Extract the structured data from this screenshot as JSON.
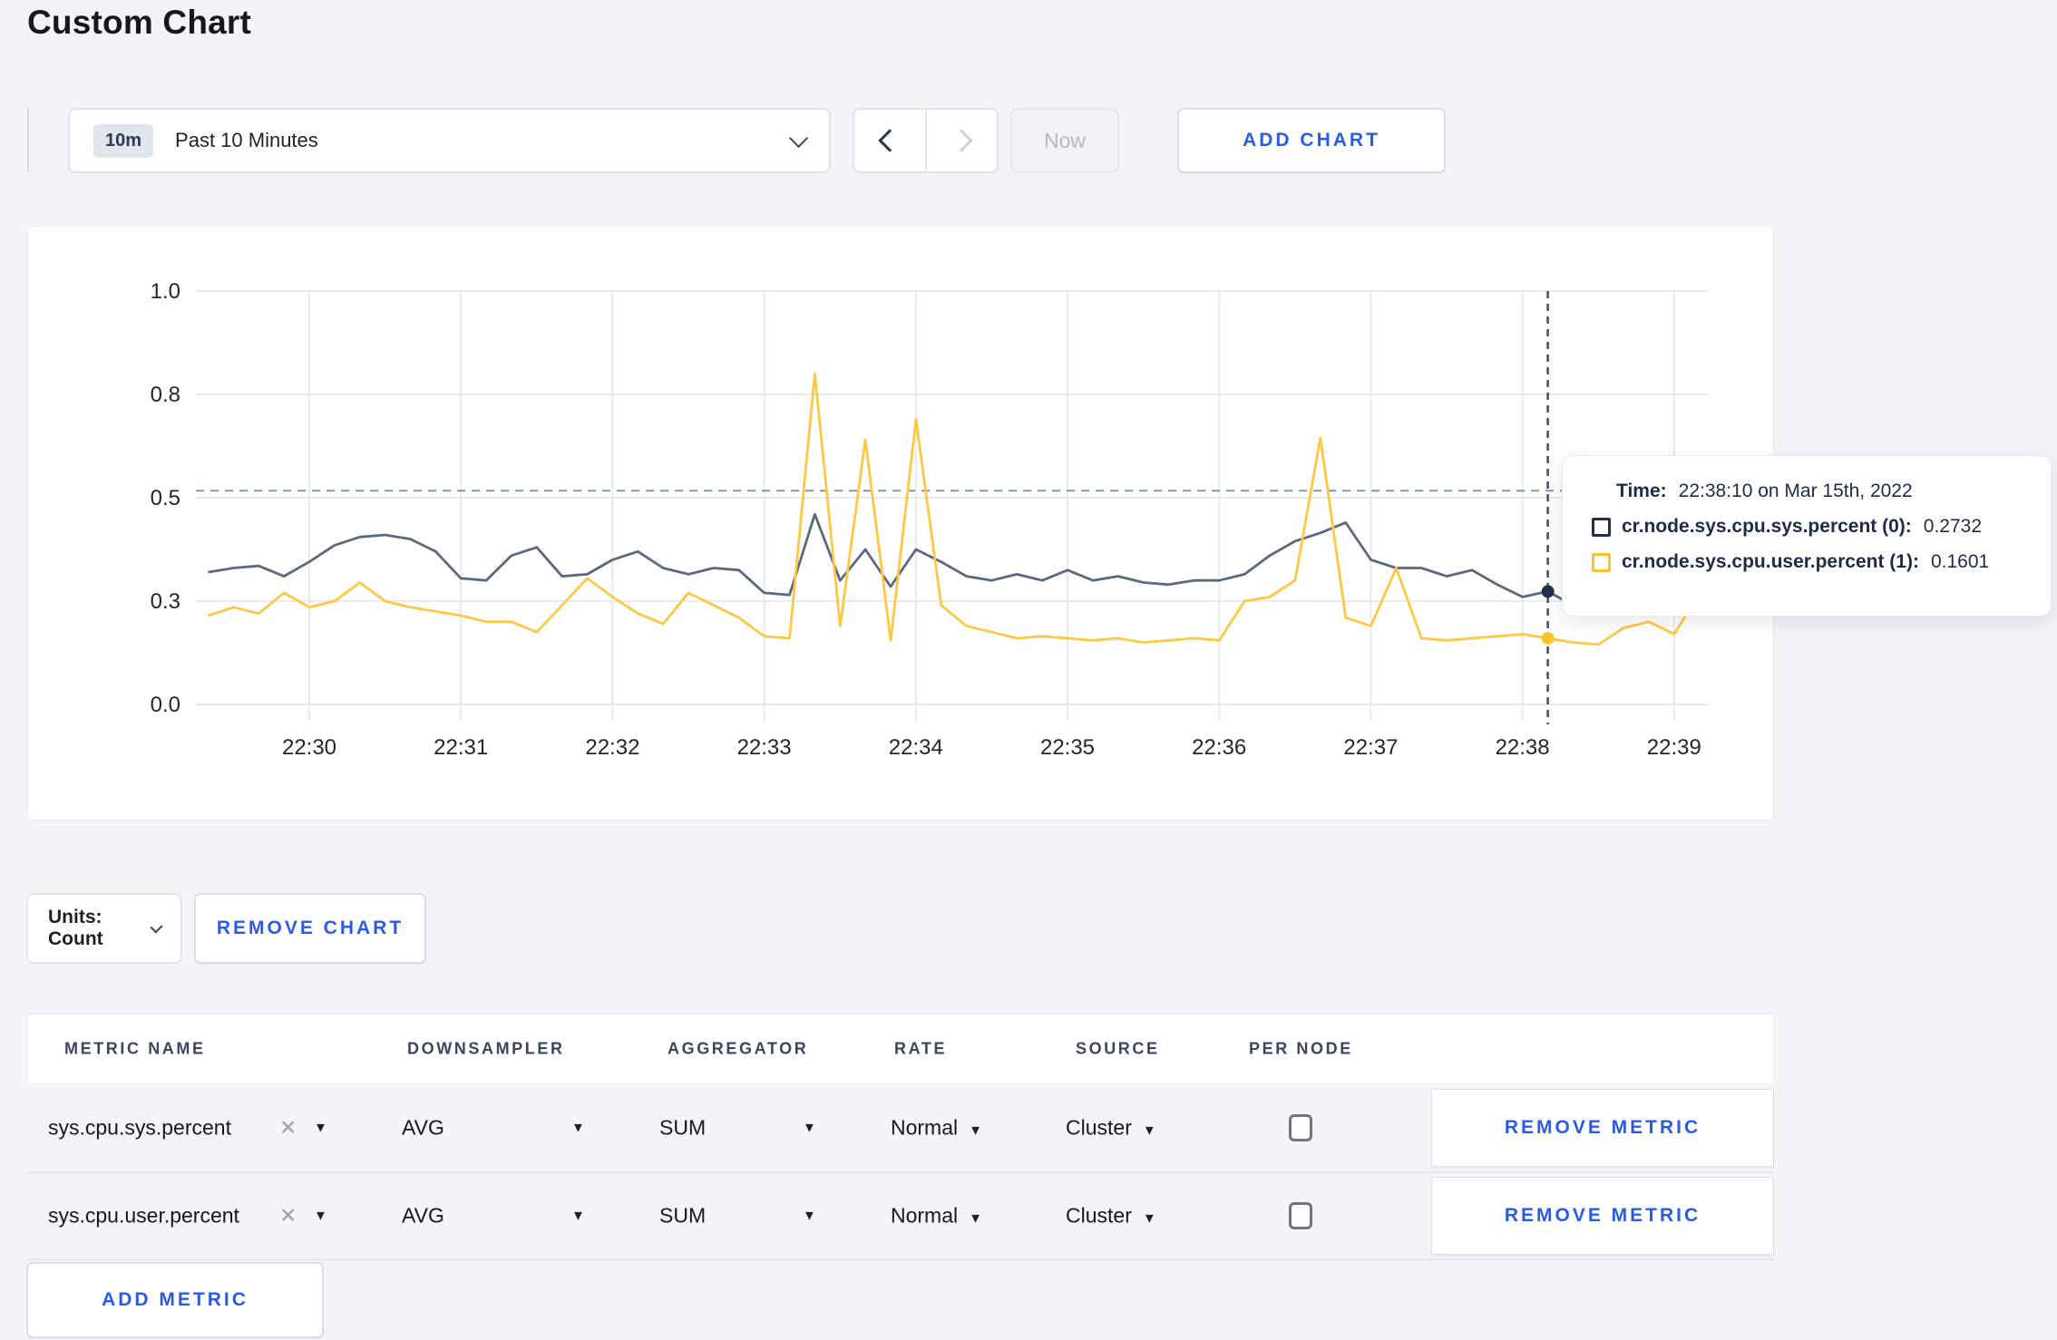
{
  "page": {
    "title": "Custom Chart"
  },
  "toolbar": {
    "time_range": {
      "badge": "10m",
      "label": "Past 10 Minutes"
    },
    "now_label": "Now",
    "add_chart_label": "ADD CHART"
  },
  "chart_data": {
    "type": "line",
    "title": "",
    "xlabel": "",
    "ylabel": "",
    "y_range": [
      0,
      1
    ],
    "grid": true,
    "legend_position": "tooltip",
    "y_ticks": [
      {
        "value": 0.0,
        "label": "0.0"
      },
      {
        "value": 0.25,
        "label": "0.3"
      },
      {
        "value": 0.5,
        "label": "0.5"
      },
      {
        "value": 0.75,
        "label": "0.8"
      },
      {
        "value": 1.0,
        "label": "1.0"
      }
    ],
    "x_ticks": [
      "22:30",
      "22:31",
      "22:32",
      "22:33",
      "22:34",
      "22:35",
      "22:36",
      "22:37",
      "22:38",
      "22:39"
    ],
    "start_time": "22:29:20",
    "interval_seconds": 10,
    "guide_line_value": 0.517,
    "crosshair_index": 53,
    "crosshair_time": "22:38:10",
    "series": [
      {
        "name": "cr.node.sys.cpu.sys.percent",
        "color": "#5b6880",
        "swatch": "#223049",
        "values": [
          0.32,
          0.33,
          0.335,
          0.31,
          0.345,
          0.385,
          0.405,
          0.41,
          0.4,
          0.37,
          0.305,
          0.3,
          0.36,
          0.38,
          0.31,
          0.315,
          0.35,
          0.37,
          0.33,
          0.315,
          0.33,
          0.325,
          0.27,
          0.265,
          0.46,
          0.3,
          0.375,
          0.285,
          0.375,
          0.345,
          0.31,
          0.3,
          0.315,
          0.3,
          0.325,
          0.3,
          0.31,
          0.295,
          0.29,
          0.3,
          0.3,
          0.315,
          0.36,
          0.395,
          0.415,
          0.44,
          0.35,
          0.33,
          0.33,
          0.31,
          0.325,
          0.29,
          0.26,
          0.2732,
          0.24,
          0.26,
          0.29,
          0.3,
          0.31,
          0.3
        ]
      },
      {
        "name": "cr.node.sys.cpu.user.percent",
        "color": "#ffc844",
        "swatch": "#ffc12e",
        "values": [
          0.215,
          0.235,
          0.22,
          0.27,
          0.235,
          0.25,
          0.295,
          0.25,
          0.235,
          0.225,
          0.215,
          0.2,
          0.2,
          0.175,
          0.24,
          0.305,
          0.26,
          0.22,
          0.195,
          0.27,
          0.24,
          0.21,
          0.165,
          0.16,
          0.8,
          0.19,
          0.64,
          0.155,
          0.69,
          0.24,
          0.19,
          0.175,
          0.16,
          0.165,
          0.16,
          0.155,
          0.16,
          0.15,
          0.155,
          0.16,
          0.155,
          0.25,
          0.26,
          0.3,
          0.645,
          0.21,
          0.19,
          0.33,
          0.16,
          0.155,
          0.16,
          0.165,
          0.17,
          0.1601,
          0.15,
          0.145,
          0.185,
          0.2,
          0.17,
          0.27
        ]
      }
    ]
  },
  "tooltip": {
    "time_label": "Time:",
    "time_value": "22:38:10 on Mar 15th, 2022",
    "rows": [
      {
        "label": "cr.node.sys.cpu.sys.percent (0):",
        "value": "0.2732"
      },
      {
        "label": "cr.node.sys.cpu.user.percent (1):",
        "value": "0.1601"
      }
    ]
  },
  "chart_controls": {
    "units_label": "Units: Count",
    "remove_chart_label": "REMOVE CHART"
  },
  "metrics_table": {
    "headers": [
      "METRIC NAME",
      "DOWNSAMPLER",
      "AGGREGATOR",
      "RATE",
      "SOURCE",
      "PER NODE"
    ],
    "rows": [
      {
        "metric_name": "sys.cpu.sys.percent",
        "downsampler": "AVG",
        "aggregator": "SUM",
        "rate": "Normal",
        "source": "Cluster",
        "per_node_checked": false,
        "remove_label": "REMOVE METRIC"
      },
      {
        "metric_name": "sys.cpu.user.percent",
        "downsampler": "AVG",
        "aggregator": "SUM",
        "rate": "Normal",
        "source": "Cluster",
        "per_node_checked": false,
        "remove_label": "REMOVE METRIC"
      }
    ],
    "add_metric_label": "ADD METRIC"
  },
  "colors": {
    "page_background": "#f3f4f8",
    "accent_blue": "#2a5be2",
    "grid_line": "#e9eaec",
    "guide_dash": "#8493a8",
    "crosshair": "#3f506b",
    "axis_text": "#22262d"
  }
}
